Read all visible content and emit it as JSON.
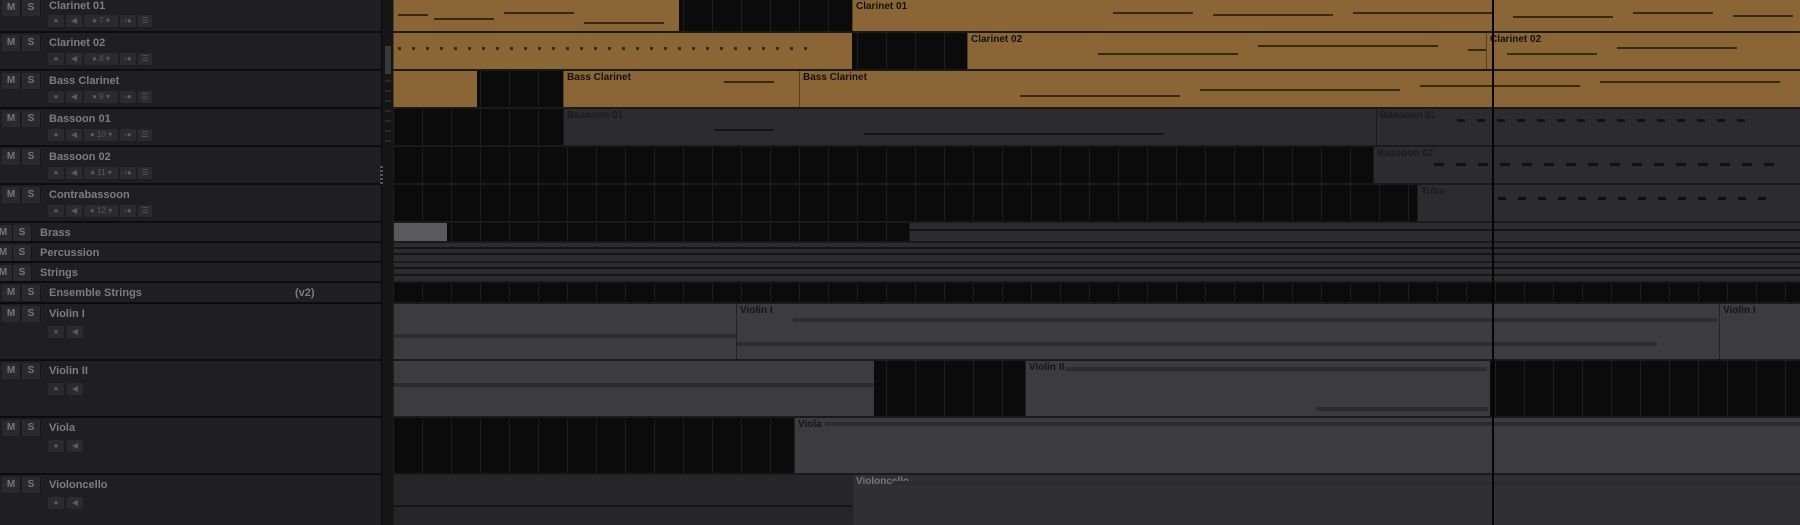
{
  "tracks": [
    {
      "name": "Clarinet 01",
      "mute": "M",
      "solo": "S",
      "channel": "7",
      "kind": "instrument"
    },
    {
      "name": "Clarinet 02",
      "mute": "M",
      "solo": "S",
      "channel": "8",
      "kind": "instrument"
    },
    {
      "name": "Bass Clarinet",
      "mute": "M",
      "solo": "S",
      "channel": "9",
      "kind": "instrument"
    },
    {
      "name": "Bassoon 01",
      "mute": "M",
      "solo": "S",
      "channel": "10",
      "kind": "instrument"
    },
    {
      "name": "Bassoon 02",
      "mute": "M",
      "solo": "S",
      "channel": "11",
      "kind": "instrument"
    },
    {
      "name": "Contrabassoon",
      "mute": "M",
      "solo": "S",
      "channel": "12",
      "kind": "instrument"
    },
    {
      "name": "Brass",
      "mute": "M",
      "solo": "S",
      "kind": "folder"
    },
    {
      "name": "Percussion",
      "mute": "M",
      "solo": "S",
      "kind": "folder"
    },
    {
      "name": "Strings",
      "mute": "M",
      "solo": "S",
      "kind": "folder"
    },
    {
      "name": "Ensemble Strings",
      "mute": "M",
      "solo": "S",
      "version": "(v2)",
      "kind": "ensemble"
    },
    {
      "name": "Violin I",
      "mute": "M",
      "solo": "S",
      "kind": "audio"
    },
    {
      "name": "Violin II",
      "mute": "M",
      "solo": "S",
      "kind": "audio"
    },
    {
      "name": "Viola",
      "mute": "M",
      "solo": "S",
      "kind": "audio"
    },
    {
      "name": "Violoncello",
      "mute": "M",
      "solo": "S",
      "kind": "audio"
    }
  ],
  "clips": {
    "clarinet01": [
      "Clarinet 01"
    ],
    "clarinet02": [
      "Clarinet 02",
      "Clarinet 02"
    ],
    "bassclarinet": [
      "Bass Clarinet",
      "Bass Clarinet"
    ],
    "bassoon01": [
      "Bassoon 01",
      "Bassoon 01"
    ],
    "bassoon02": [
      "Bassoon 02"
    ],
    "contrabassoon": [
      "Tuba"
    ],
    "violin1": [
      "Violin I",
      "Violin I"
    ],
    "violin2": [
      "Violin II"
    ],
    "viola": [
      "Viola"
    ],
    "violoncello": [
      "Violoncello"
    ]
  },
  "colors": {
    "wood": "#8a6636",
    "background": "#0b0b0c",
    "panel": "#1f1f21"
  },
  "icons": [
    "record-icon",
    "monitor-icon",
    "channel-icon",
    "dropdown-icon",
    "edit-instrument-icon",
    "instrument-rack-icon"
  ]
}
